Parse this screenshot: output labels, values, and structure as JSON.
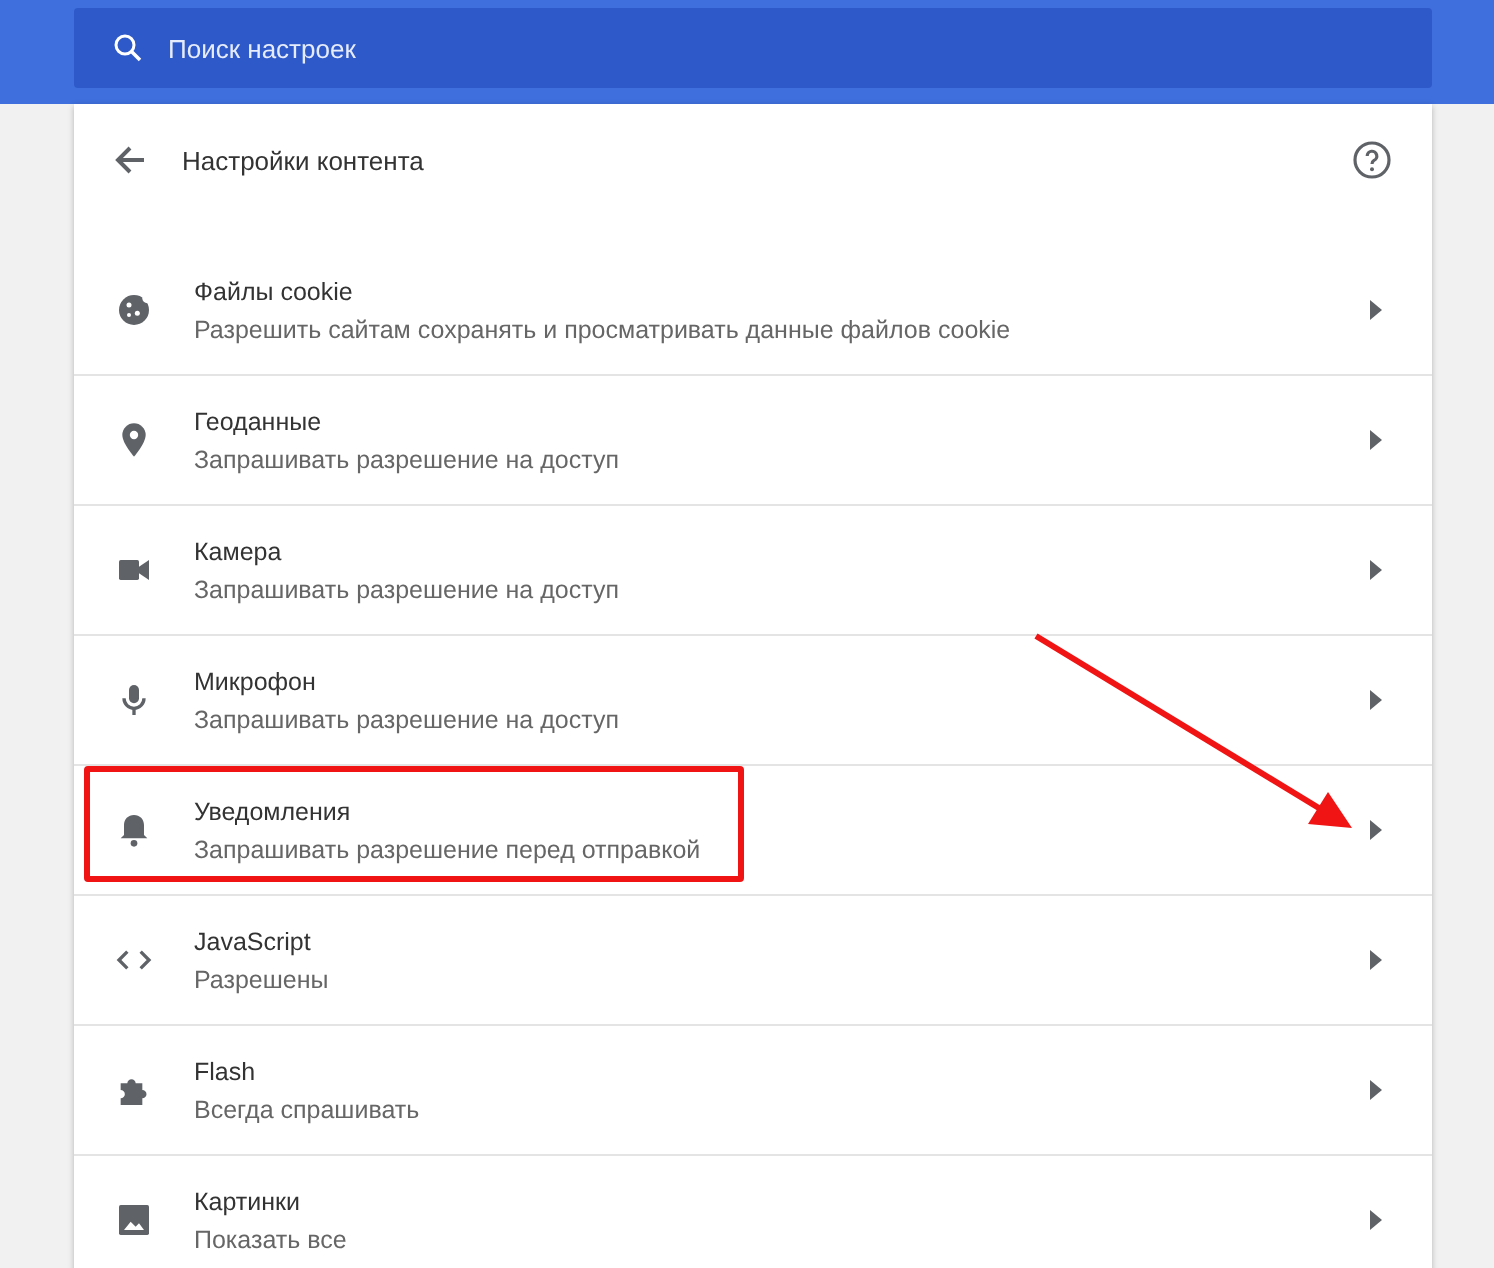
{
  "search": {
    "placeholder": "Поиск настроек"
  },
  "page": {
    "title": "Настройки контента"
  },
  "items": [
    {
      "kind": "cookie",
      "title": "Файлы cookie",
      "subtitle": "Разрешить сайтам сохранять и просматривать данные файлов cookie",
      "highlighted": false
    },
    {
      "kind": "location",
      "title": "Геоданные",
      "subtitle": "Запрашивать разрешение на доступ",
      "highlighted": false
    },
    {
      "kind": "camera",
      "title": "Камера",
      "subtitle": "Запрашивать разрешение на доступ",
      "highlighted": false
    },
    {
      "kind": "mic",
      "title": "Микрофон",
      "subtitle": "Запрашивать разрешение на доступ",
      "highlighted": false
    },
    {
      "kind": "bell",
      "title": "Уведомления",
      "subtitle": "Запрашивать разрешение перед отправкой",
      "highlighted": true
    },
    {
      "kind": "code",
      "title": "JavaScript",
      "subtitle": "Разрешены",
      "highlighted": false
    },
    {
      "kind": "puzzle",
      "title": "Flash",
      "subtitle": "Всегда спрашивать",
      "highlighted": false
    },
    {
      "kind": "image",
      "title": "Картинки",
      "subtitle": "Показать все",
      "highlighted": false
    }
  ]
}
